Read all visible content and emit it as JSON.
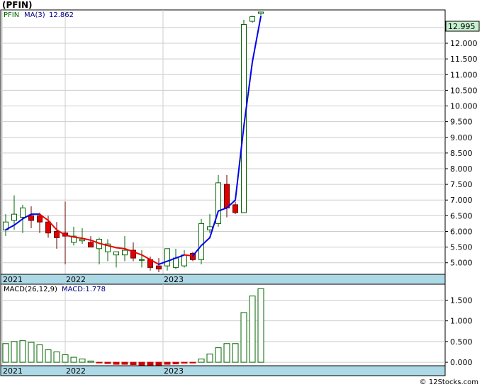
{
  "title": "(PFIN)",
  "credit": "© 12Stocks.com",
  "colors": {
    "up_fill": "#ffffff",
    "up_stroke": "#006400",
    "down_fill": "#e00000",
    "down_stroke": "#660000",
    "ma_up": "#0000ee",
    "ma_down": "#ee0000",
    "macd_pos": "#006400",
    "macd_neg": "#cc0000",
    "date_band": "#add8e6",
    "grid": "#cccccc",
    "price_tag_bg": "#c6efce"
  },
  "chart_data": [
    {
      "type": "candlestick",
      "legend": {
        "symbol": "PFIN",
        "ma_label": "MA(3)",
        "ma_value": "12.862"
      },
      "last_price_label": "12.995",
      "ylim": [
        4.7,
        12.995
      ],
      "y_ticks": [
        "5.000",
        "5.500",
        "6.000",
        "6.500",
        "7.000",
        "7.500",
        "8.000",
        "8.500",
        "9.000",
        "9.500",
        "10.000",
        "10.500",
        "11.000",
        "11.500",
        "12.000",
        "12.500"
      ],
      "x_labels": [
        {
          "label": "2021",
          "index": 0
        },
        {
          "label": "2022",
          "index": 7
        },
        {
          "label": "2023",
          "index": 18.5
        }
      ],
      "candles": [
        {
          "o": 6.05,
          "h": 6.55,
          "l": 5.85,
          "c": 6.3
        },
        {
          "o": 6.35,
          "h": 7.15,
          "l": 6.05,
          "c": 6.55
        },
        {
          "o": 6.45,
          "h": 6.85,
          "l": 5.95,
          "c": 6.75
        },
        {
          "o": 6.5,
          "h": 6.8,
          "l": 6.1,
          "c": 6.35
        },
        {
          "o": 6.5,
          "h": 6.6,
          "l": 5.95,
          "c": 6.3
        },
        {
          "o": 6.3,
          "h": 6.5,
          "l": 5.8,
          "c": 5.95
        },
        {
          "o": 6.0,
          "h": 6.3,
          "l": 5.45,
          "c": 5.8
        },
        {
          "o": 5.95,
          "h": 6.95,
          "l": 4.95,
          "c": 5.85
        },
        {
          "o": 5.65,
          "h": 6.15,
          "l": 5.55,
          "c": 5.85
        },
        {
          "o": 5.7,
          "h": 6.1,
          "l": 5.6,
          "c": 5.75
        },
        {
          "o": 5.65,
          "h": 5.85,
          "l": 5.5,
          "c": 5.5
        },
        {
          "o": 5.45,
          "h": 5.8,
          "l": 4.95,
          "c": 5.75
        },
        {
          "o": 5.35,
          "h": 5.75,
          "l": 5.05,
          "c": 5.6
        },
        {
          "o": 5.25,
          "h": 5.35,
          "l": 4.85,
          "c": 5.35
        },
        {
          "o": 5.25,
          "h": 5.85,
          "l": 5.05,
          "c": 5.4
        },
        {
          "o": 5.4,
          "h": 5.65,
          "l": 5.05,
          "c": 5.15
        },
        {
          "o": 5.1,
          "h": 5.4,
          "l": 4.85,
          "c": 5.1
        },
        {
          "o": 5.1,
          "h": 5.2,
          "l": 4.75,
          "c": 4.85
        },
        {
          "o": 4.9,
          "h": 5.15,
          "l": 4.7,
          "c": 4.8
        },
        {
          "o": 4.9,
          "h": 5.45,
          "l": 4.75,
          "c": 5.45
        },
        {
          "o": 4.85,
          "h": 5.45,
          "l": 4.8,
          "c": 5.15
        },
        {
          "o": 4.9,
          "h": 5.4,
          "l": 4.85,
          "c": 5.25
        },
        {
          "o": 5.3,
          "h": 5.35,
          "l": 5.05,
          "c": 5.1
        },
        {
          "o": 5.1,
          "h": 6.4,
          "l": 4.95,
          "c": 6.25
        },
        {
          "o": 6.05,
          "h": 6.55,
          "l": 5.95,
          "c": 6.15
        },
        {
          "o": 6.25,
          "h": 7.8,
          "l": 6.15,
          "c": 7.55
        },
        {
          "o": 7.5,
          "h": 7.8,
          "l": 6.45,
          "c": 6.75
        },
        {
          "o": 6.85,
          "h": 6.95,
          "l": 6.55,
          "c": 6.6
        },
        {
          "o": 6.6,
          "h": 12.75,
          "l": 6.6,
          "c": 12.6
        },
        {
          "o": 12.7,
          "h": 12.88,
          "l": 12.65,
          "c": 12.85
        },
        {
          "o": 12.95,
          "h": 12.995,
          "l": 12.9,
          "c": 12.995
        }
      ],
      "ma": [
        6.05,
        6.2,
        6.4,
        6.55,
        6.55,
        6.35,
        6.05,
        5.88,
        5.82,
        5.78,
        5.72,
        5.62,
        5.55,
        5.48,
        5.45,
        5.35,
        5.25,
        5.1,
        4.95,
        5.05,
        5.15,
        5.25,
        5.22,
        5.55,
        5.8,
        6.65,
        6.75,
        7.0,
        9.35,
        11.4,
        12.862
      ]
    },
    {
      "type": "bar",
      "legend": {
        "label": "MACD(26,12,9)",
        "macd_label": "MACD:1.778"
      },
      "ylim": [
        -0.05,
        1.85
      ],
      "y_ticks": [
        "0.000",
        "0.500",
        "1.000",
        "1.500"
      ],
      "x_labels": [
        {
          "label": "2021",
          "index": 0
        },
        {
          "label": "2022",
          "index": 7
        },
        {
          "label": "2023",
          "index": 18.5
        }
      ],
      "values": [
        0.45,
        0.5,
        0.52,
        0.48,
        0.42,
        0.3,
        0.25,
        0.18,
        0.12,
        0.08,
        0.03,
        -0.01,
        -0.03,
        -0.05,
        -0.05,
        -0.06,
        -0.07,
        -0.08,
        -0.08,
        -0.05,
        -0.04,
        -0.02,
        -0.01,
        0.08,
        0.2,
        0.35,
        0.45,
        0.45,
        1.2,
        1.6,
        1.778
      ]
    }
  ]
}
